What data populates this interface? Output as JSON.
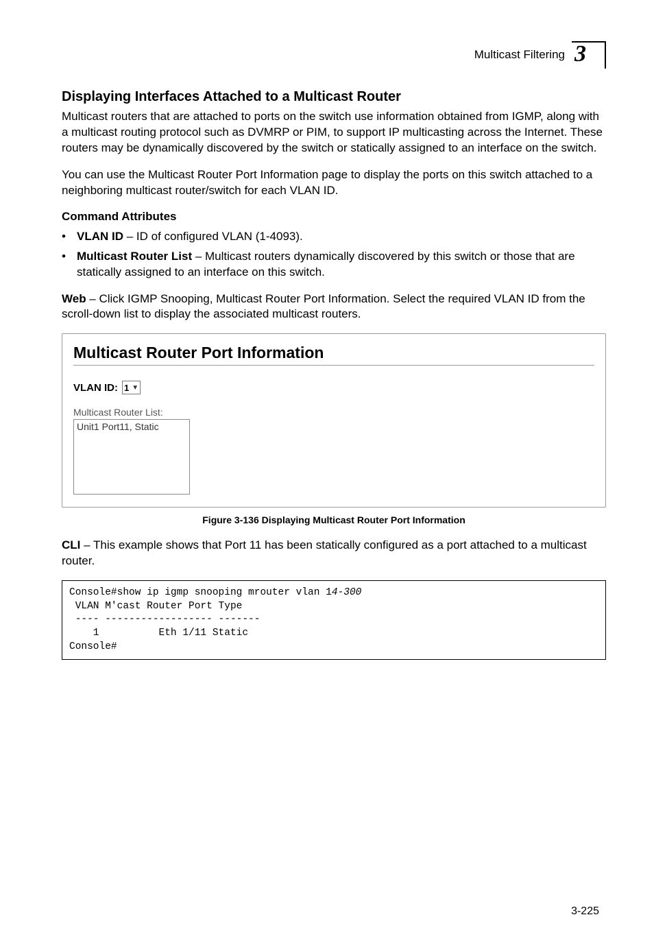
{
  "header": {
    "running": "Multicast Filtering",
    "chapter": "3"
  },
  "section": {
    "title": "Displaying Interfaces Attached to a Multicast Router",
    "para1": "Multicast routers that are attached to ports on the switch use information obtained from IGMP, along with a multicast routing protocol such as DVMRP or PIM, to support IP multicasting across the Internet. These routers may be dynamically discovered by the switch or statically assigned to an interface on the switch.",
    "para2": "You can use the Multicast Router Port Information page to display the ports on this switch attached to a neighboring multicast router/switch for each VLAN ID.",
    "cmd_attr_heading": "Command Attributes",
    "bullets": [
      {
        "term": "VLAN ID",
        "desc": " – ID of configured VLAN (1-4093)."
      },
      {
        "term": "Multicast Router List",
        "desc": " – Multicast routers dynamically discovered by this switch or those that are statically assigned to an interface on this switch."
      }
    ],
    "web_lead": "Web",
    "web_rest": " – Click IGMP Snooping, Multicast Router Port Information. Select the required VLAN ID from the scroll-down list to display the associated multicast routers."
  },
  "screenshot": {
    "title": "Multicast Router Port Information",
    "vlan_label": "VLAN ID:",
    "vlan_value": "1",
    "mr_label": "Multicast Router List:",
    "mr_item": "Unit1 Port11, Static"
  },
  "figure_caption": "Figure 3-136  Displaying Multicast Router Port Information",
  "cli": {
    "lead": "CLI",
    "rest": " – This example shows that Port 11 has been statically configured as a port attached to a multicast router."
  },
  "code": {
    "line1a": "Console#show ip igmp snooping mrouter vlan 1",
    "line1b": "4-300",
    "line2": " VLAN M'cast Router Port Type",
    "line3": " ---- ------------------ -------",
    "line4": "    1          Eth 1/11 Static",
    "line5": "Console#"
  },
  "page_number": "3-225"
}
